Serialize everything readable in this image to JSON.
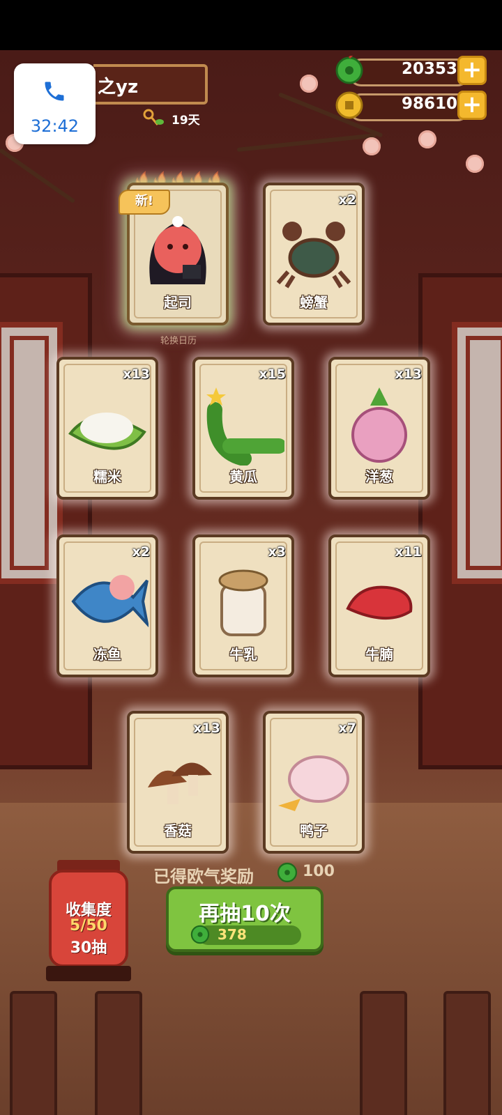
{
  "status": {
    "call_timer": "32:42"
  },
  "player": {
    "name": "之yz",
    "days": "19天"
  },
  "currencies": [
    {
      "icon": "jade-coin-icon",
      "value": "20353"
    },
    {
      "icon": "gold-coin-icon",
      "value": "98610"
    }
  ],
  "banner": {
    "new_tag": "新!",
    "calendar_label": "轮换日历"
  },
  "cards": [
    {
      "label": "起司",
      "count": "",
      "icon": "character-cheese-icon",
      "special": true
    },
    {
      "label": "螃蟹",
      "count": "x2",
      "icon": "crab-icon"
    },
    {
      "label": "糯米",
      "count": "x13",
      "icon": "rice-icon"
    },
    {
      "label": "黄瓜",
      "count": "x15",
      "icon": "cucumber-icon"
    },
    {
      "label": "洋葱",
      "count": "x13",
      "icon": "onion-icon"
    },
    {
      "label": "冻鱼",
      "count": "x2",
      "icon": "frozen-fish-icon"
    },
    {
      "label": "牛乳",
      "count": "x3",
      "icon": "milk-jar-icon"
    },
    {
      "label": "牛腩",
      "count": "x11",
      "icon": "beef-icon"
    },
    {
      "label": "香菇",
      "count": "x13",
      "icon": "mushroom-icon"
    },
    {
      "label": "鸭子",
      "count": "x7",
      "icon": "duck-icon"
    }
  ],
  "reward": {
    "text": "已得欧气奖励",
    "value": "100"
  },
  "draw_button": {
    "label": "再抽10次",
    "cost": "378"
  },
  "collection": {
    "title": "收集度",
    "progress": "5/50",
    "draws": "30抽"
  }
}
